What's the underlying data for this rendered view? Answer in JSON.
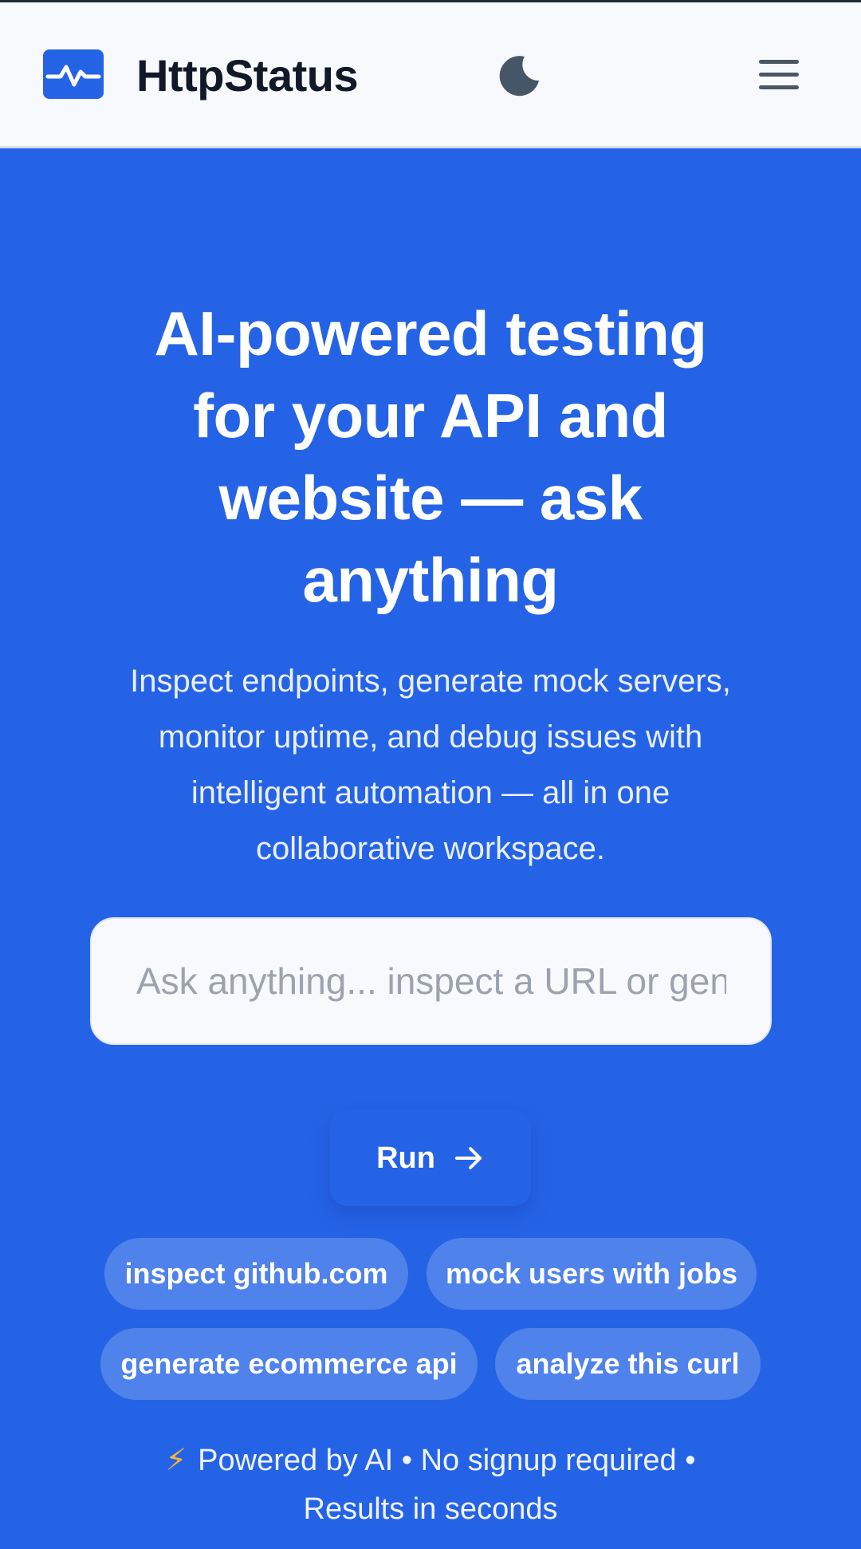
{
  "header": {
    "brand": "HttpStatus",
    "logo_icon": "activity-pulse-icon",
    "theme_icon": "moon-icon",
    "menu_icon": "hamburger-menu-icon"
  },
  "hero": {
    "headline_lines": [
      "AI-powered testing",
      "for your API and",
      "website — ask",
      "anything"
    ],
    "subtitle_lines": [
      "Inspect endpoints, generate mock servers,",
      "monitor uptime, and debug issues with",
      "intelligent automation — all in one",
      "collaborative workspace."
    ],
    "search": {
      "placeholder": "Ask anything... inspect a URL or generate a mock API",
      "value": ""
    },
    "run_label": "Run",
    "run_icon": "arrow-right-icon",
    "chips": [
      "inspect github.com",
      "mock users with jobs",
      "generate ecommerce api",
      "analyze this curl"
    ],
    "footer_icon": "lightning-bolt-icon",
    "footer_lines": [
      "Powered by AI • No signup required •",
      "Results in seconds"
    ]
  },
  "colors": {
    "primary": "#2563e6",
    "header_bg": "#f7f9fc",
    "brand_text": "#111827",
    "bolt": "#f4b63c"
  }
}
